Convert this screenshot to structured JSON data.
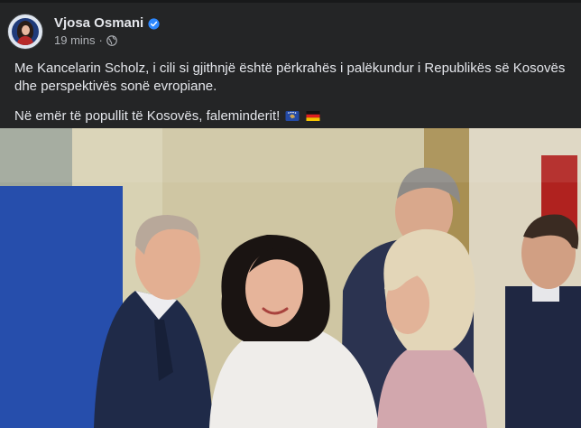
{
  "post": {
    "author": "Vjosa Osmani",
    "time": "19 mins",
    "separator": "·",
    "privacy_icon": "globe-icon",
    "verified_icon": "verified-badge-icon",
    "text_line_1": "Me Kancelarin Scholz, i cili si gjithnjë është përkrahës i palëkundur i Republikës së Kosovës dhe perspektivës sonë evropiane.",
    "text_line_2": "Në emër të popullit të Kosovës, faleminderit!",
    "emojis": [
      "flag-kosovo-icon",
      "flag-germany-icon"
    ]
  },
  "colors": {
    "background": "#242526",
    "text_primary": "#e4e6eb",
    "text_secondary": "#b0b3b8",
    "verified": "#2d88ff"
  }
}
